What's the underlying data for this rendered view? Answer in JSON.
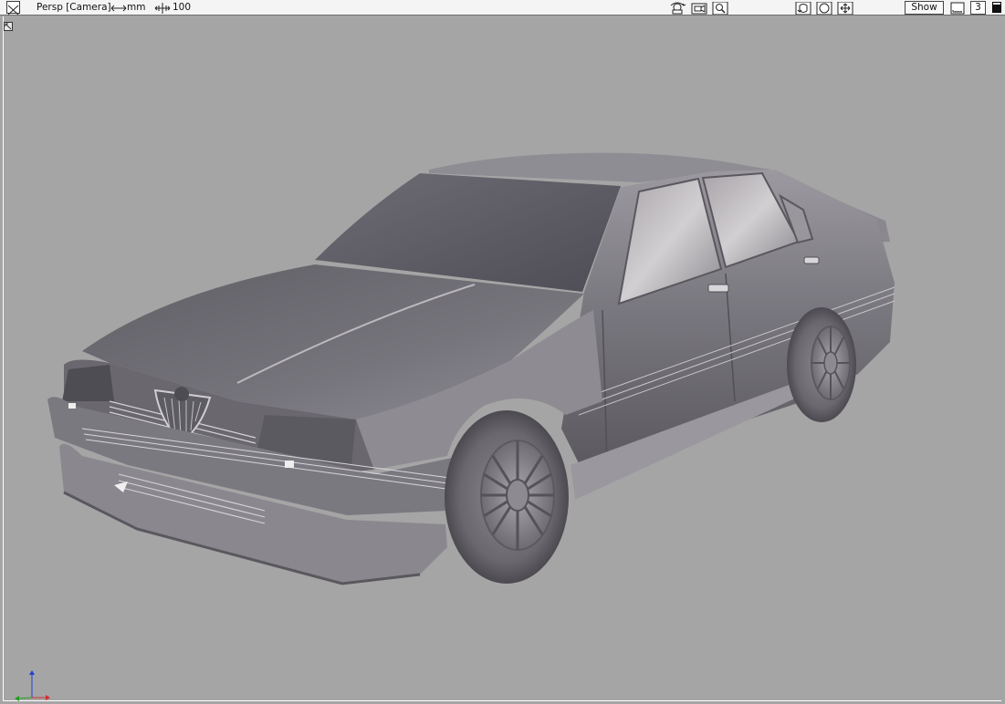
{
  "toolbar": {
    "view_label": "Persp [Camera]",
    "unit_label": "mm",
    "scale_value": "100",
    "show_label": "Show",
    "layout_number": "3"
  },
  "icons": [
    "close-icon",
    "unit-arrows-icon",
    "grid-scale-icon",
    "camera-tumble-icon",
    "camera-track-icon",
    "zoom-icon",
    "rotate-view-icon",
    "look-at-icon",
    "pan-view-icon",
    "bookmark-icon",
    "window-toggle-icon",
    "resize-corner-icon",
    "axis-triad-icon"
  ],
  "colors": {
    "viewport_bg": "#a5a5a5",
    "toolbar_bg": "#f4f4f4",
    "axis_x": "#d03030",
    "axis_y": "#20a020",
    "axis_z": "#2040d0"
  }
}
